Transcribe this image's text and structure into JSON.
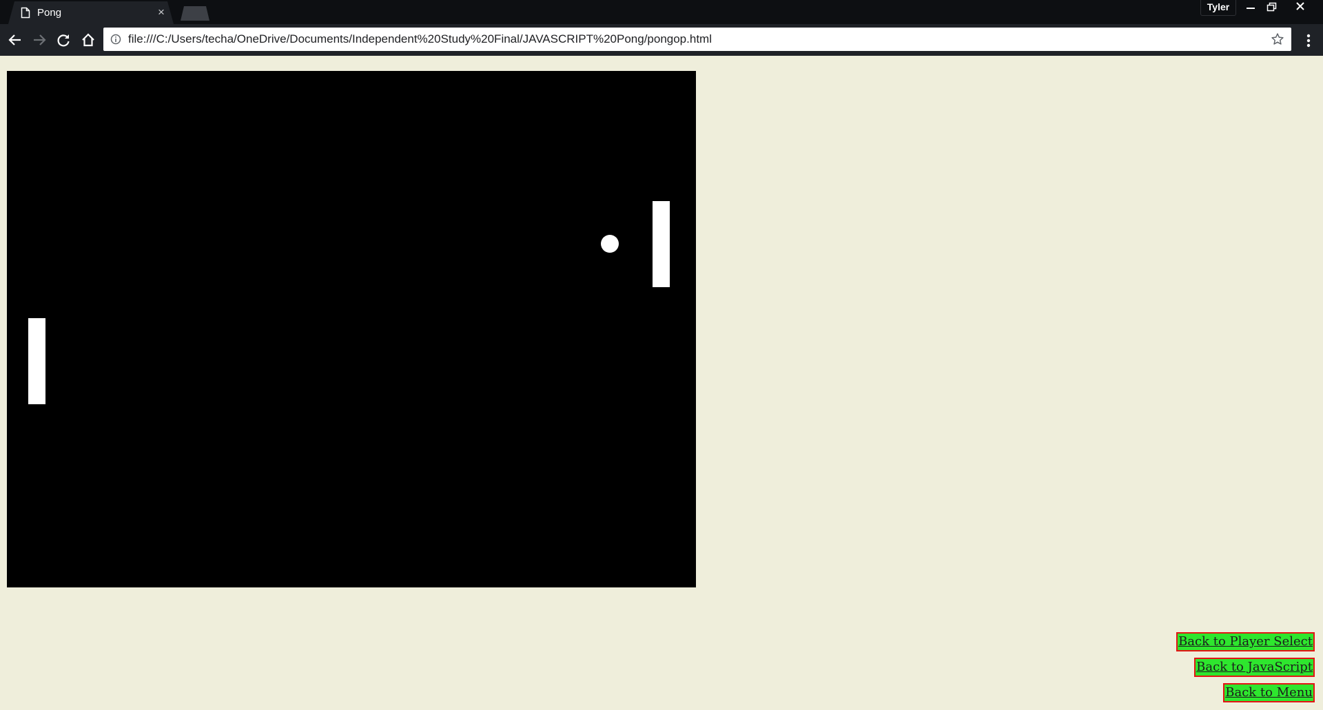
{
  "browser": {
    "tab_title": "Pong",
    "tab_close_glyph": "×",
    "profile_name": "Tyler",
    "url": "file:///C:/Users/techa/OneDrive/Documents/Independent%20Study%20Final/JAVASCRIPT%20Pong/pongop.html",
    "icons": {
      "tab": "page-icon",
      "back": "back-arrow-icon",
      "forward": "forward-arrow-icon",
      "reload": "reload-icon",
      "home": "home-icon",
      "site_info": "info-icon",
      "bookmark": "star-icon",
      "menu": "more-vert-icon",
      "minimize": "minimize-icon",
      "restore": "restore-icon",
      "close": "close-icon"
    }
  },
  "game": {
    "canvas_color": "#000000",
    "piece_color": "#ffffff"
  },
  "links": [
    {
      "label": "Back to Player Select"
    },
    {
      "label": "Back to JavaScript"
    },
    {
      "label": "Back to Menu"
    }
  ],
  "colors": {
    "page_background": "#efeedb",
    "link_background": "#2ee62e",
    "link_border": "#e31414"
  }
}
